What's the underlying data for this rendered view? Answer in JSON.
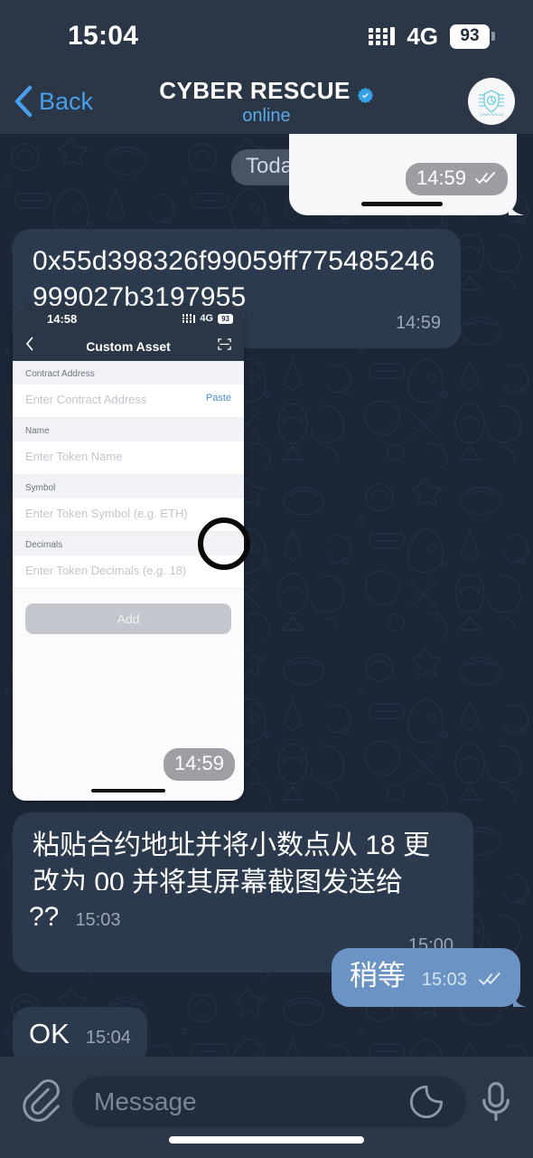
{
  "status_bar": {
    "time": "15:04",
    "network": "4G",
    "battery": "93",
    "signal_icon": "signal-bars-icon",
    "battery_icon": "battery-icon"
  },
  "header": {
    "back_label": "Back",
    "back_icon": "chevron-left-icon",
    "title": "CYBER RESCUE",
    "verified_icon": "verified-badge-icon",
    "status": "online",
    "avatar_name": "avatar"
  },
  "chat": {
    "date_divider": "Today",
    "messages": [
      {
        "id": "photo-preview",
        "type": "photo",
        "direction": "out",
        "time": "14:59",
        "ticks": "double-check-icon"
      },
      {
        "id": "contract-address",
        "type": "text",
        "direction": "in",
        "text": "0x55d398326f99059ff775485246999027b3197955",
        "time": "14:59"
      },
      {
        "id": "custom-asset-screenshot",
        "type": "photo",
        "direction": "in",
        "time": "14:59"
      },
      {
        "id": "instruction",
        "type": "text",
        "direction": "in",
        "text": "粘贴合约地址并将小数点从 18 更改为 00 并将其屏幕截图发送给我。",
        "time": "15:00"
      },
      {
        "id": "question-marks",
        "type": "text",
        "direction": "in",
        "text": "??",
        "time": "15:03"
      },
      {
        "id": "wait-reply",
        "type": "text",
        "direction": "out",
        "text": "稍等",
        "time": "15:03",
        "ticks": "double-check-icon"
      },
      {
        "id": "ok-reply",
        "type": "text",
        "direction": "in",
        "text": "OK",
        "time": "15:04"
      }
    ]
  },
  "embedded_screenshot": {
    "status_bar": {
      "time": "14:58",
      "network": "4G",
      "battery": "93"
    },
    "nav": {
      "back_icon": "chevron-left-icon",
      "title": "Custom Asset",
      "scan_icon": "scan-qr-icon"
    },
    "fields": [
      {
        "label": "Contract Address",
        "placeholder": "Enter Contract Address",
        "action": "Paste"
      },
      {
        "label": "Name",
        "placeholder": "Enter Token Name"
      },
      {
        "label": "Symbol",
        "placeholder": "Enter Token Symbol (e.g. ETH)"
      },
      {
        "label": "Decimals",
        "placeholder": "Enter Token Decimals (e.g. 18)"
      }
    ],
    "submit_label": "Add",
    "annotation": "circle-highlight-paste"
  },
  "composer": {
    "attach_icon": "paperclip-icon",
    "placeholder": "Message",
    "sticker_icon": "sticker-icon",
    "mic_icon": "microphone-icon"
  },
  "colors": {
    "background": "#1c2636",
    "header": "#2b3647",
    "bubble_in": "#2b3a4d",
    "bubble_out": "#6b94c4",
    "accent": "#4a9eea",
    "status_online": "#5aa9e8"
  }
}
